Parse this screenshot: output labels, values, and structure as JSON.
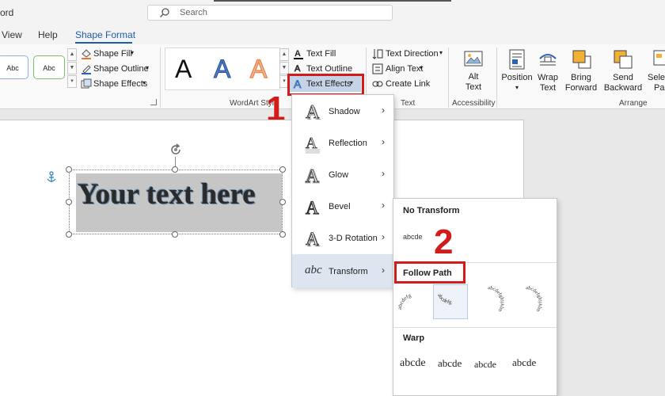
{
  "app": {
    "name_fragment": "ord"
  },
  "search": {
    "placeholder": "Search"
  },
  "tabs": {
    "view": "View",
    "help": "Help",
    "shape_format": "Shape Format"
  },
  "shape_styles": {
    "swatch1": "Abc",
    "swatch2": "Abc",
    "shape_fill": "Shape Fill",
    "shape_outline": "Shape Outline",
    "shape_effects": "Shape Effects"
  },
  "wordart": {
    "sample_letter": "A",
    "group_label": "WordArt Styl",
    "text_fill": "Text Fill",
    "text_outline": "Text Outline",
    "text_effects": "Text Effects"
  },
  "text_group": {
    "text_direction": "Text Direction",
    "align_text": "Align Text",
    "create_link": "Create Link",
    "label": "Text"
  },
  "accessibility": {
    "alt_text_1": "Alt",
    "alt_text_2": "Text",
    "label": "Accessibility"
  },
  "arrange": {
    "position": "Position",
    "wrap_1": "Wrap",
    "wrap_2": "Text",
    "bring_1": "Bring",
    "bring_2": "Forward",
    "send_1": "Send",
    "send_2": "Backward",
    "select_1": "Selec",
    "select_2": "Pa",
    "label": "Arrange"
  },
  "document": {
    "textbox_text": "Your text here"
  },
  "effects_menu": {
    "items": [
      {
        "label": "Shadow",
        "icon": "shadow-icon"
      },
      {
        "label": "Reflection",
        "icon": "reflection-icon"
      },
      {
        "label": "Glow",
        "icon": "glow-icon"
      },
      {
        "label": "Bevel",
        "icon": "bevel-icon"
      },
      {
        "label": "3-D Rotation",
        "icon": "3d-rotation-icon"
      },
      {
        "label": "Transform",
        "icon": "transform-icon"
      }
    ],
    "transform_icon_text": "abc"
  },
  "transform_menu": {
    "no_transform": "No Transform",
    "sample": "abcde",
    "follow_path": "Follow Path",
    "warp": "Warp",
    "follow_path_samples": [
      "abcdefg",
      "abcdefg",
      "abcdefghijklm",
      "abcdefghijklm"
    ],
    "warp_samples": [
      "abcde",
      "abcde",
      "abcde",
      "abcde"
    ]
  },
  "annotations": {
    "step1": "1",
    "step2": "2",
    "color": "#d21c1c"
  },
  "colors": {
    "accent": "#1e5ea8",
    "wordart_blue": "#4a7cc7",
    "wordart_peach": "#f0a880",
    "highlight": "#dde5f0"
  }
}
